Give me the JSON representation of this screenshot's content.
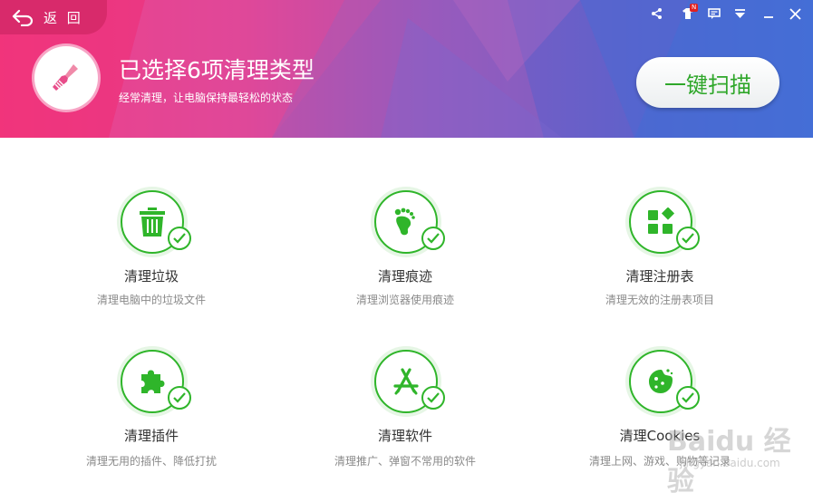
{
  "colors": {
    "accent": "#2fb52a",
    "header_pink": "#f23b7e",
    "header_blue": "#3f72d8"
  },
  "header": {
    "back_label": "返 回",
    "title": "已选择6项清理类型",
    "subtitle": "经常清理，让电脑保持最轻松的状态",
    "scan_button": "一键扫描",
    "controls": [
      "share-icon",
      "shirt-icon",
      "message-icon",
      "dropdown-icon",
      "minimize-icon",
      "close-icon"
    ],
    "shirt_badge": "N"
  },
  "items": [
    {
      "icon": "trash-icon",
      "title": "清理垃圾",
      "desc": "清理电脑中的垃圾文件"
    },
    {
      "icon": "footprint-icon",
      "title": "清理痕迹",
      "desc": "清理浏览器使用痕迹"
    },
    {
      "icon": "registry-icon",
      "title": "清理注册表",
      "desc": "清理无效的注册表项目"
    },
    {
      "icon": "puzzle-icon",
      "title": "清理插件",
      "desc": "清理无用的插件、降低打扰"
    },
    {
      "icon": "appstore-icon",
      "title": "清理软件",
      "desc": "清理推广、弹窗不常用的软件"
    },
    {
      "icon": "cookie-icon",
      "title": "清理Cookies",
      "desc": "清理上网、游戏、购物等记录"
    }
  ],
  "watermark": {
    "text": "Baidu 经验",
    "url": "jingyan.baidu.com"
  }
}
